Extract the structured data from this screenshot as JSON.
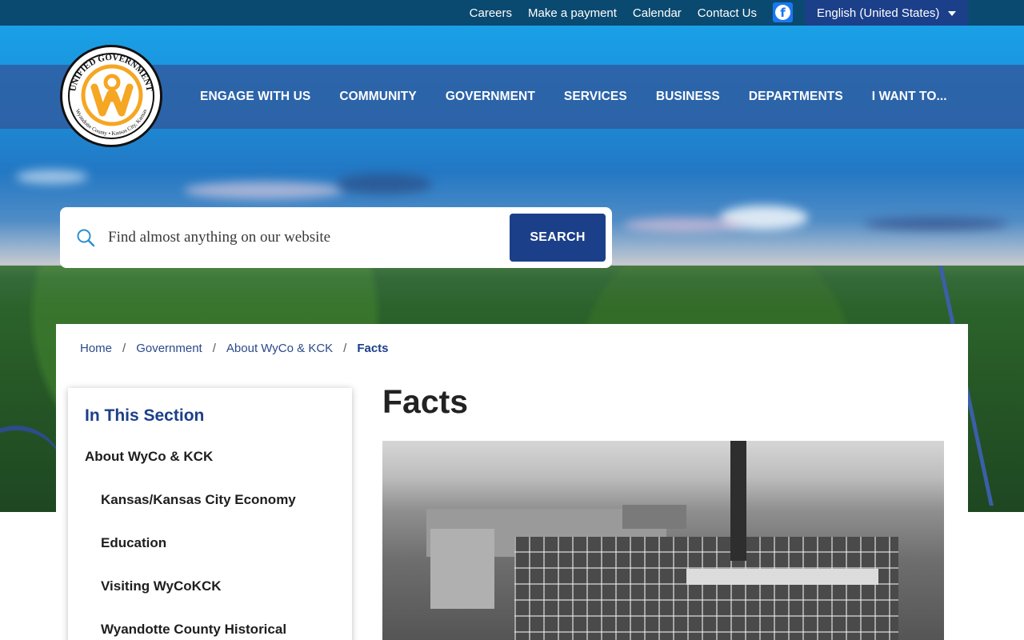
{
  "utility": {
    "links": [
      "Careers",
      "Make a payment",
      "Calendar",
      "Contact Us"
    ],
    "facebook_icon": "facebook-icon",
    "language": "English (United States)"
  },
  "logo": {
    "top_text": "UNIFIED GOVERNMENT",
    "bottom_text": "Wyandotte County • Kansas City, Kansas",
    "accent": "#f5a623"
  },
  "nav": {
    "items": [
      "ENGAGE WITH US",
      "COMMUNITY",
      "GOVERNMENT",
      "SERVICES",
      "BUSINESS",
      "DEPARTMENTS",
      "I WANT TO..."
    ]
  },
  "search": {
    "placeholder": "Find almost anything on our website",
    "button_label": "SEARCH",
    "icon": "search-icon"
  },
  "breadcrumb": {
    "items": [
      "Home",
      "Government",
      "About WyCo & KCK"
    ],
    "current": "Facts",
    "separator": "/"
  },
  "section_nav": {
    "title": "In This Section",
    "parent": "About WyCo & KCK",
    "children": [
      "Kansas/Kansas City Economy",
      "Education",
      "Visiting WyCoKCK",
      "Wyandotte County Historical"
    ]
  },
  "page": {
    "title": "Facts"
  },
  "colors": {
    "brand_blue": "#1c3f8a",
    "utility_bar": "#0b4a70",
    "nav_band": "#315a9e"
  }
}
